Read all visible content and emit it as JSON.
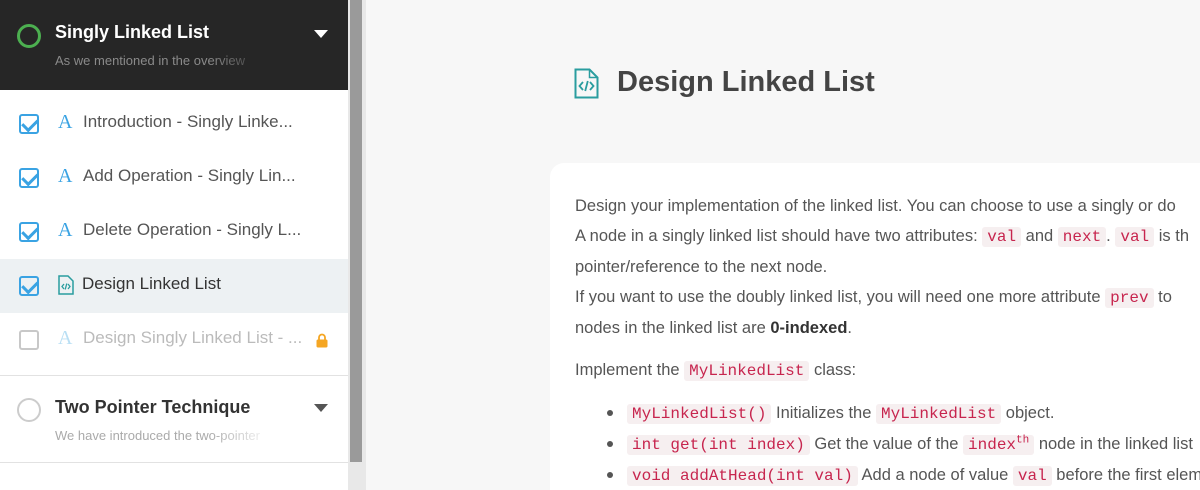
{
  "sidebar": {
    "active_chapter": {
      "title": "Singly Linked List",
      "subtitle": "As we mentioned in the overview"
    },
    "lessons": [
      {
        "label": "Introduction - Singly Linke...",
        "type": "article",
        "done": true
      },
      {
        "label": "Add Operation - Singly Lin...",
        "type": "article",
        "done": true
      },
      {
        "label": "Delete Operation - Singly L...",
        "type": "article",
        "done": true
      },
      {
        "label": "Design Linked List",
        "type": "code",
        "done": true,
        "selected": true
      },
      {
        "label": "Design Singly Linked List - ...",
        "type": "article",
        "done": false,
        "locked": true
      }
    ],
    "next_chapter": {
      "title": "Two Pointer Technique",
      "subtitle": "We have introduced the two-pointer"
    }
  },
  "main": {
    "title": "Design Linked List",
    "para1_a": "Design your implementation of the linked list. You can choose to use a singly or do",
    "para1_b": "A node in a singly linked list should have two attributes: ",
    "code_val": "val",
    "and": " and ",
    "code_next": "next",
    "period_space": ". ",
    "is_the": " is th",
    "para1_c": "pointer/reference to the next node.",
    "para1_d": "If you want to use the doubly linked list, you will need one more attribute ",
    "code_prev": "prev",
    "to": " to",
    "para1_e_a": "nodes in the linked list are ",
    "zero_indexed": "0-indexed",
    "period": ".",
    "implement": "Implement the ",
    "class_name": "MyLinkedList",
    "class_suffix": " class:",
    "methods": [
      {
        "code": "MyLinkedList()",
        "text_a": " Initializes the ",
        "code2": "MyLinkedList",
        "text_b": " object."
      },
      {
        "code": "int get(int index)",
        "text_a": " Get the value of the ",
        "code2": "index",
        "sup": "th",
        "text_b": " node in the linked list"
      },
      {
        "code": "void addAtHead(int val)",
        "text_a": " Add a node of value ",
        "code2": "val",
        "text_b": " before the first elem"
      }
    ]
  },
  "colors": {
    "accent_blue": "#3aa3e3",
    "progress_green": "#4caf50",
    "lock_orange": "#f5a623",
    "code_red": "#c7254e",
    "doc_icon_teal": "#2a9d9f"
  }
}
